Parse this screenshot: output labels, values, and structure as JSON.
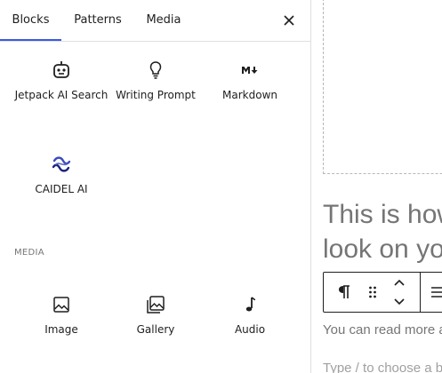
{
  "inserter": {
    "tabs": [
      {
        "label": "Blocks",
        "active": true
      },
      {
        "label": "Patterns",
        "active": false
      },
      {
        "label": "Media",
        "active": false
      }
    ],
    "close_icon": "close-icon",
    "blocks": [
      {
        "label": "Jetpack AI Search",
        "icon": "robot-icon"
      },
      {
        "label": "Writing Prompt",
        "icon": "lightbulb-icon"
      },
      {
        "label": "Markdown",
        "icon": "markdown-icon"
      },
      {
        "label": "CAIDEL AI",
        "icon": "caidel-logo-icon"
      }
    ],
    "media_section_title": "MEDIA",
    "media_blocks": [
      {
        "label": "Image",
        "icon": "image-icon"
      },
      {
        "label": "Gallery",
        "icon": "gallery-icon"
      },
      {
        "label": "Audio",
        "icon": "audio-icon"
      }
    ],
    "accent_color": "#3858e9"
  },
  "editor": {
    "heading": "This is how\nlook on yo",
    "paragraph": "You can read more a",
    "append_placeholder": "Type / to choose a b",
    "toolbar": {
      "buttons": [
        "paragraph-icon",
        "drag-handle-icon",
        "move-up-icon",
        "move-down-icon",
        "align-icon"
      ]
    }
  }
}
